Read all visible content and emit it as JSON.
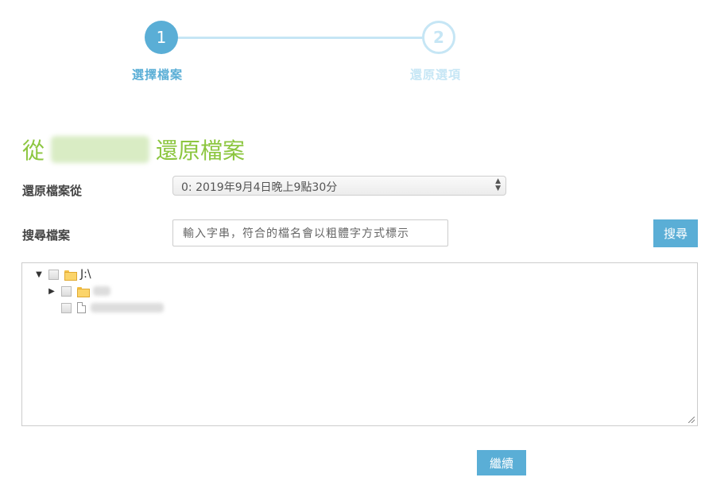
{
  "steps": [
    {
      "number": "1",
      "label": "選擇檔案"
    },
    {
      "number": "2",
      "label": "還原選項"
    }
  ],
  "title": {
    "prefix": "從",
    "suffix": "還原檔案"
  },
  "restore_from": {
    "label": "還原檔案從",
    "selected": "0: 2019年9月4日晚上9點30分"
  },
  "search": {
    "label": "搜尋檔案",
    "placeholder": "輸入字串，符合的檔名會以粗體字方式標示",
    "button": "搜尋"
  },
  "tree": {
    "root": {
      "name": "J:\\"
    }
  },
  "colors": {
    "accent": "#5aaed6",
    "step_inactive": "#c6e6f5",
    "title": "#8cc63f"
  },
  "continue_button": "繼續"
}
